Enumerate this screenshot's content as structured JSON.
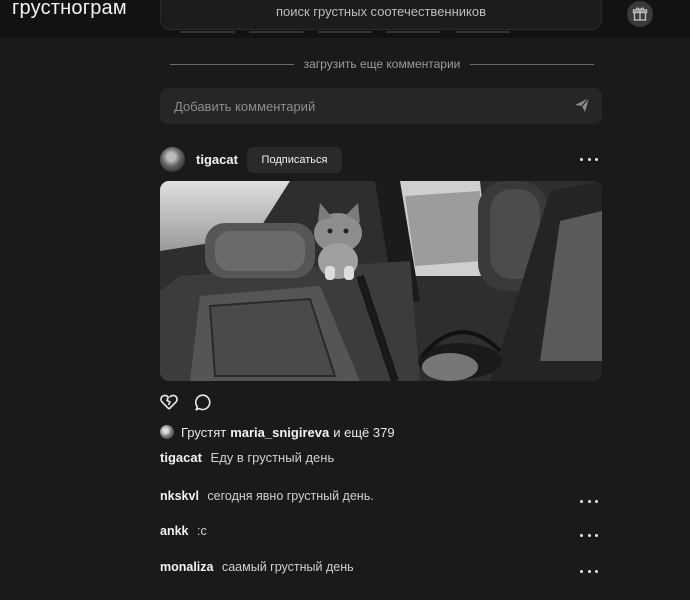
{
  "header": {
    "logo": "грустнограм",
    "search_placeholder": "поиск грустных соотечественников",
    "gift_icon": "gift-icon"
  },
  "comments_section": {
    "load_more_label": "загрузить еще комментарии",
    "add_comment_placeholder": "Добавить комментарий",
    "send_icon": "send-icon"
  },
  "post": {
    "author": "tigacat",
    "follow_label": "Подписаться",
    "image_alt_icon": "photo-cat-in-car",
    "likes": {
      "prefix": "Грустят",
      "user": "maria_snigireva",
      "suffix": "и ещё 379"
    },
    "caption": {
      "user": "tigacat",
      "text": "Еду в грустный день"
    },
    "comments": [
      {
        "user": "nkskvl",
        "text": "сегодня явно грустный день."
      },
      {
        "user": "ankk",
        "text": ":с"
      },
      {
        "user": "monaliza",
        "text": "саамый грустный день"
      }
    ]
  },
  "colors": {
    "background": "#1a1a1a",
    "header": "#121212",
    "input": "#262626",
    "text": "#e8e8e8"
  }
}
